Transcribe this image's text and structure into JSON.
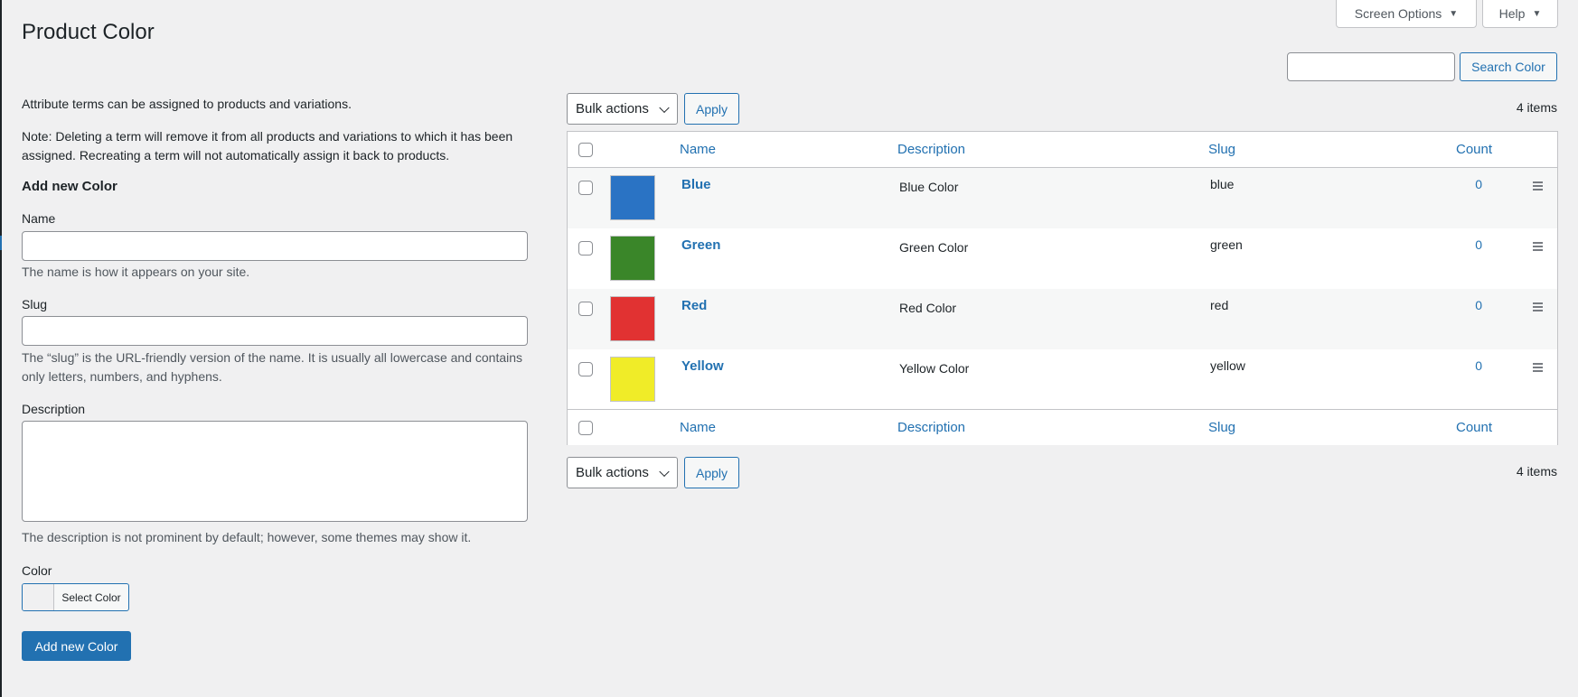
{
  "header": {
    "screen_options_label": "Screen Options",
    "help_label": "Help",
    "page_title": "Product Color"
  },
  "search": {
    "placeholder": "",
    "button_label": "Search Color"
  },
  "form": {
    "intro": "Attribute terms can be assigned to products and variations.",
    "note": "Note: Deleting a term will remove it from all products and variations to which it has been assigned. Recreating a term will not automatically assign it back to products.",
    "heading": "Add new Color",
    "name_label": "Name",
    "name_value": "",
    "name_help": "The name is how it appears on your site.",
    "slug_label": "Slug",
    "slug_value": "",
    "slug_help": "The “slug” is the URL-friendly version of the name. It is usually all lowercase and contains only letters, numbers, and hyphens.",
    "description_label": "Description",
    "description_value": "",
    "description_help": "The description is not prominent by default; however, some themes may show it.",
    "color_label": "Color",
    "select_color_label": "Select Color",
    "submit_label": "Add new Color"
  },
  "list": {
    "bulk_actions_label": "Bulk actions",
    "apply_label": "Apply",
    "items_count": "4 items",
    "columns": {
      "name": "Name",
      "description": "Description",
      "slug": "Slug",
      "count": "Count"
    },
    "rows": [
      {
        "name": "Blue",
        "description": "Blue Color",
        "slug": "blue",
        "count": "0",
        "color": "#2a73c4"
      },
      {
        "name": "Green",
        "description": "Green Color",
        "slug": "green",
        "count": "0",
        "color": "#3a8629"
      },
      {
        "name": "Red",
        "description": "Red Color",
        "slug": "red",
        "count": "0",
        "color": "#e13232"
      },
      {
        "name": "Yellow",
        "description": "Yellow Color",
        "slug": "yellow",
        "count": "0",
        "color": "#f0ec28"
      }
    ]
  },
  "colors": {
    "accent": "#2271b1",
    "background": "#f0f0f1"
  },
  "icons": {
    "drag_handle": "drag-handle-icon",
    "caret": "caret-down-icon"
  }
}
